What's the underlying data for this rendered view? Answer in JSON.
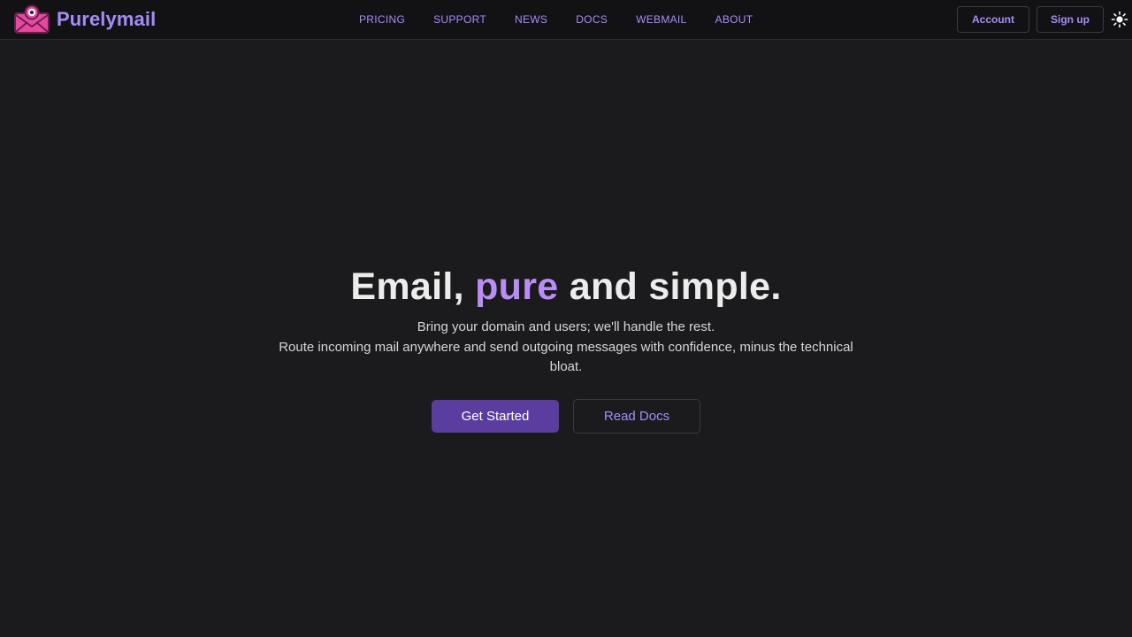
{
  "brand": {
    "name": "Purelymail",
    "logo_icon": "envelope-eye-icon",
    "colors": {
      "accent": "#a78bfa",
      "logo_pink": "#e64aa0",
      "logo_outline": "#6a1f4d",
      "primary_button": "#5b3da0",
      "background": "#1b1b1d",
      "navbar": "#121214"
    }
  },
  "nav": {
    "links": [
      {
        "label": "PRICING"
      },
      {
        "label": "SUPPORT"
      },
      {
        "label": "NEWS"
      },
      {
        "label": "DOCS"
      },
      {
        "label": "WEBMAIL"
      },
      {
        "label": "ABOUT"
      }
    ],
    "account_label": "Account",
    "signup_label": "Sign up",
    "theme_icon": "sun-icon"
  },
  "hero": {
    "title_before": "Email, ",
    "title_accent": "pure",
    "title_after": " and simple.",
    "subtitle_line1": "Bring your domain and users; we'll handle the rest.",
    "subtitle_line2": "Route incoming mail anywhere and send outgoing messages with confidence, minus the technical bloat.",
    "primary_cta": "Get Started",
    "secondary_cta": "Read Docs"
  }
}
